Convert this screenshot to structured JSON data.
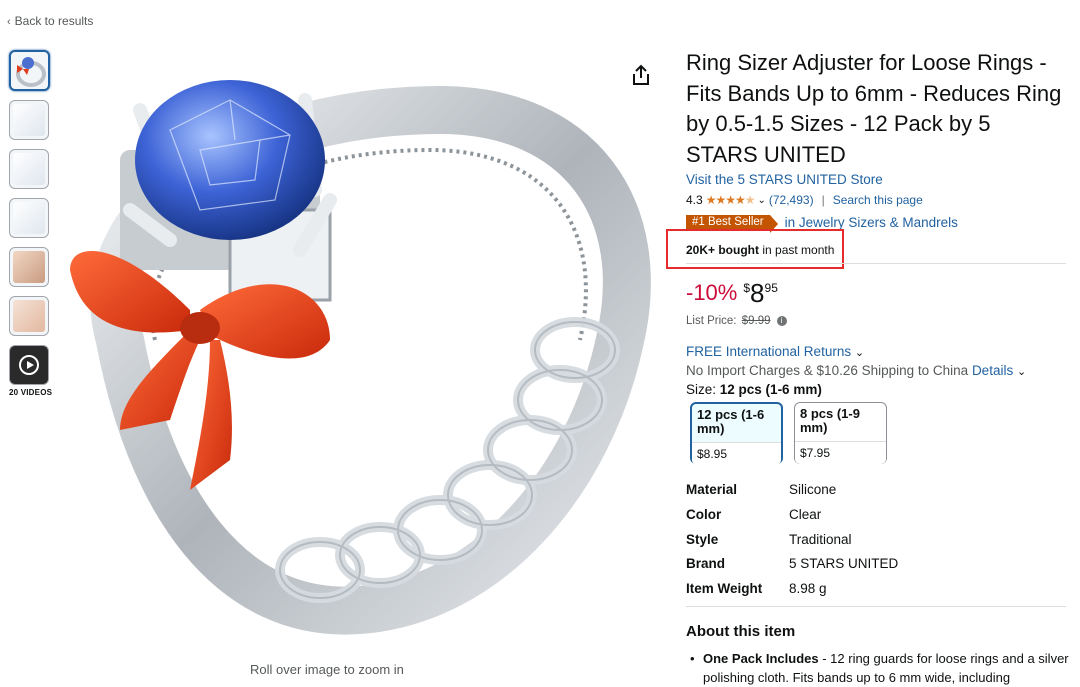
{
  "nav": {
    "back_label": "Back to results"
  },
  "gallery": {
    "thumb_count": 7,
    "videos_label": "20 VIDEOS",
    "zoom_hint": "Roll over image to zoom in"
  },
  "product": {
    "title": "Ring Sizer Adjuster for Loose Rings - Fits Bands Up to 6mm - Reduces Ring by 0.5-1.5 Sizes - 12 Pack by 5 STARS UNITED",
    "store_link": "Visit the 5 STARS UNITED Store",
    "rating": "4.3",
    "stars": 4.3,
    "review_count": "(72,493)",
    "search_page": "Search this page",
    "badge": "#1 Best Seller",
    "badge_category": "in Jewelry Sizers & Mandrels",
    "bought_bold": "20K+ bought",
    "bought_rest": " in past month"
  },
  "price": {
    "discount": "-10%",
    "currency": "$",
    "whole": "8",
    "fraction": "95",
    "list_label": "List Price:",
    "list_value": "$9.99"
  },
  "shipping": {
    "returns": "FREE International Returns",
    "import": "No Import Charges & $10.26 Shipping to China",
    "details": "Details"
  },
  "size": {
    "label": "Size:",
    "selected": "12 pcs (1-6 mm)",
    "options": [
      {
        "name": "12 pcs (1-6 mm)",
        "price": "$8.95"
      },
      {
        "name": "8 pcs (1-9 mm)",
        "price": "$7.95"
      }
    ]
  },
  "specs": [
    {
      "key": "Material",
      "value": "Silicone"
    },
    {
      "key": "Color",
      "value": "Clear"
    },
    {
      "key": "Style",
      "value": "Traditional"
    },
    {
      "key": "Brand",
      "value": "5 STARS UNITED"
    },
    {
      "key": "Item Weight",
      "value": "8.98 g"
    }
  ],
  "about": {
    "title": "About this item",
    "bullet_bold": "One Pack Includes",
    "bullet_text": " - 12 ring guards for loose rings and a silver polishing cloth. Fits bands up to 6 mm wide, including"
  },
  "colors": {
    "link": "#2162a1",
    "deal": "#cc0c39",
    "badge": "#c45500",
    "star": "#de7921",
    "highlight_box": "#e52b2b"
  },
  "icons": [
    "chevron-left-icon",
    "share-icon",
    "star-icon",
    "chevron-down-icon",
    "info-icon",
    "play-icon"
  ]
}
